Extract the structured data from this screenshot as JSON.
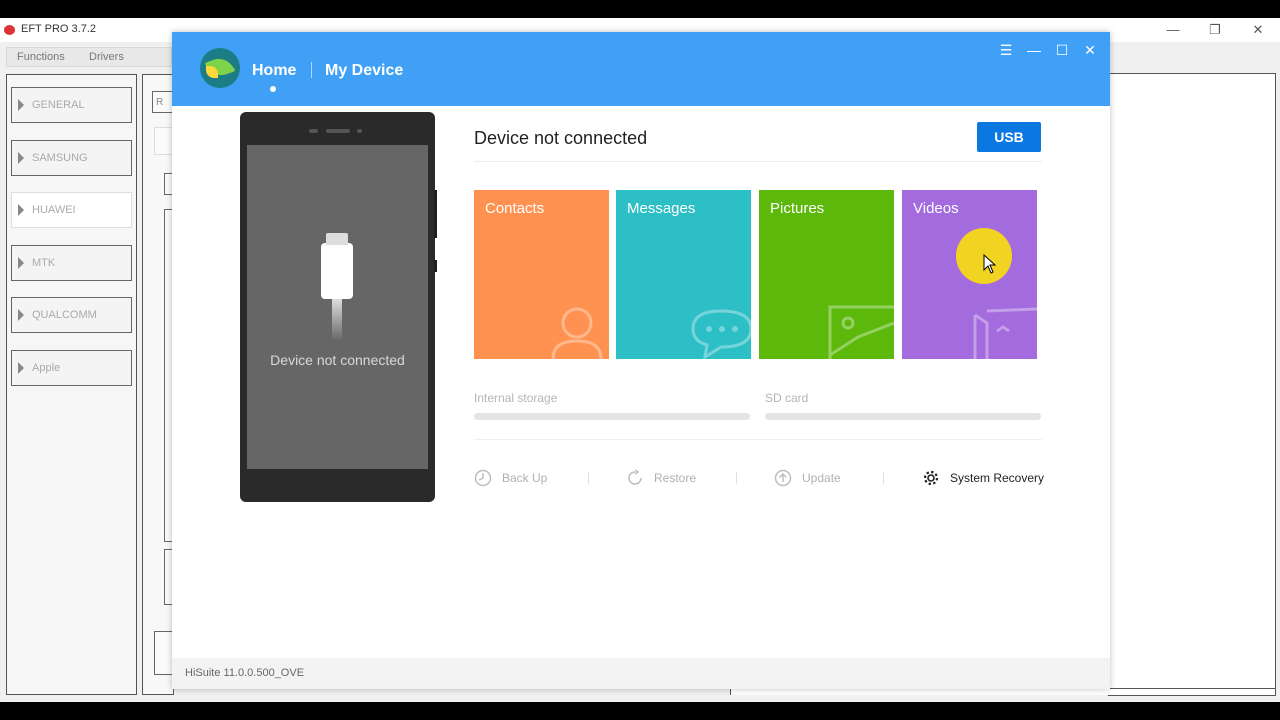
{
  "eft": {
    "title": "EFT PRO 3.7.2",
    "menu": [
      "Functions",
      "Drivers"
    ],
    "sidebar": [
      "GENERAL",
      "SAMSUNG",
      "HUAWEI",
      "MTK",
      "QUALCOMM",
      "Apple"
    ],
    "mid_label": "R",
    "window_buttons": {
      "minimize": "—",
      "restore": "❐",
      "close": "✕"
    }
  },
  "hisuite": {
    "nav": {
      "home": "Home",
      "my_device": "My Device"
    },
    "window_buttons": {
      "menu": "☰",
      "minimize": "—",
      "maximize": "☐",
      "close": "✕"
    },
    "phone_message": "Device not connected",
    "status_title": "Device not connected",
    "usb_button": "USB",
    "tiles": [
      {
        "label": "Contacts",
        "color": "#ff9250",
        "icon": "contact-icon"
      },
      {
        "label": "Messages",
        "color": "#2dbfc6",
        "icon": "chat-bubble-icon"
      },
      {
        "label": "Pictures",
        "color": "#5cb80a",
        "icon": "picture-icon"
      },
      {
        "label": "Videos",
        "color": "#a46bde",
        "icon": "video-icon"
      }
    ],
    "storage": {
      "internal": "Internal storage",
      "sd": "SD card"
    },
    "tools": [
      "Back Up",
      "Restore",
      "Update",
      "System Recovery"
    ],
    "footer_version": "HiSuite 11.0.0.500_OVE"
  },
  "colors": {
    "header_blue": "#3fa0f5",
    "usb_blue": "#0a78e0",
    "cursor_highlight": "#ffe600"
  }
}
